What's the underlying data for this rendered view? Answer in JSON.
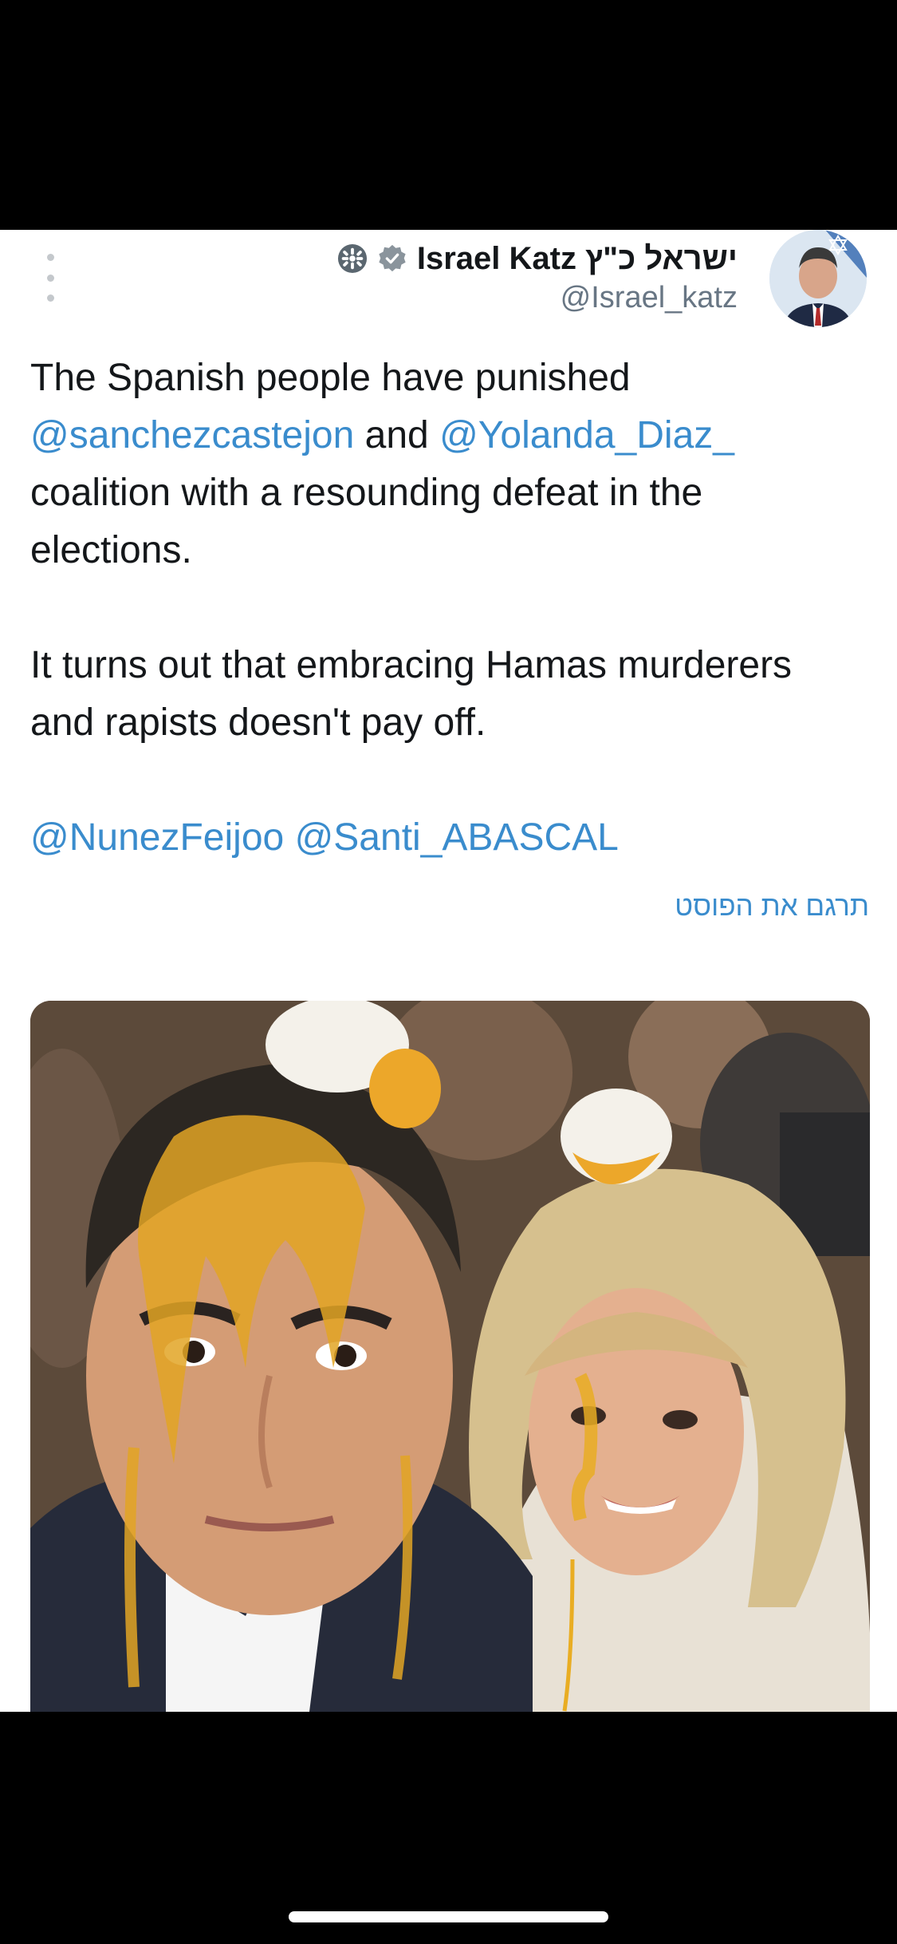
{
  "author": {
    "name": "Israel Katz ישראל כ\"ץ",
    "handle": "@Israel_katz",
    "badge_icons": [
      "government-emblem-icon",
      "verified-badge-icon"
    ]
  },
  "tweet": {
    "line1_prefix": "The Spanish people have punished",
    "mention1": "@sanchezcastejon",
    "and_word": " and ",
    "mention2": "@Yolanda_Diaz_",
    "line1_suffix": "coalition with a resounding defeat in the elections.",
    "paragraph2": "It turns out that embracing Hamas murderers and rapists doesn't pay off.",
    "mention3": "@NunezFeijoo",
    "mention4": "@Santi_ABASCAL"
  },
  "translate_label": "תרגם את הפוסט",
  "colors": {
    "link": "#3a8ccd",
    "text": "#14171a",
    "muted": "#687684"
  }
}
